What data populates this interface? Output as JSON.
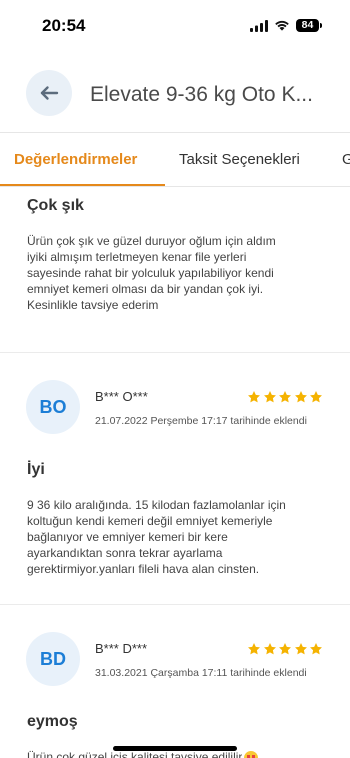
{
  "status_bar": {
    "time": "20:54",
    "battery_level": "84",
    "icons": {
      "signal": "cellular-signal-icon",
      "wifi": "wifi-icon",
      "battery": "battery-icon"
    }
  },
  "header": {
    "title": "Elevate 9-36 kg Oto K...",
    "back_icon": "arrow-left-icon"
  },
  "tabs": [
    {
      "label": "Değerlendirmeler",
      "active": true
    },
    {
      "label": "Taksit Seçenekleri",
      "active": false
    },
    {
      "label": "G",
      "active": false
    }
  ],
  "reviews": [
    {
      "title": "Çok şık",
      "body": "Ürün çok şık ve güzel duruyor oğlum için aldım\niyiki almışım terletmeyen kenar file yerleri\nsayesinde rahat bir yolculuk yapılabiliyor kendi\nemniyet kemeri olması da bir yandan çok iyi.\nKesinlikle tavsiye ederim"
    },
    {
      "initials": "BO",
      "author": "B*** O***",
      "rating": 5,
      "date": "21.07.2022 Perşembe 17:17 tarihinde eklendi",
      "title": "İyi",
      "body": "9 36 kilo aralığında. 15 kilodan fazlamolanlar için\nkoltuğun kendi kemeri değil emniyet kemeriyle\nbağlanıyor ve emniyer kemeri bir kere\nayarkandıktan sonra tekrar ayarlama\ngerektirmiyor.yanları fileli hava alan cinsten."
    },
    {
      "initials": "BD",
      "author": "B*** D***",
      "rating": 5,
      "date": "31.03.2021 Çarşamba 17:11 tarihinde eklendi",
      "title": "eymoş",
      "body": "Ürün çok güzel içiş kalitesi tavsiye edililir",
      "emoji_icon": "smiling-face-with-heart-eyes-icon"
    }
  ],
  "colors": {
    "accent": "#E5891B",
    "star": "#F5B301",
    "avatar_text": "#1C7ED6",
    "avatar_bg": "#E8F1FA",
    "back_button_bg": "#E9F0F7",
    "back_icon": "#5C6C7D"
  }
}
